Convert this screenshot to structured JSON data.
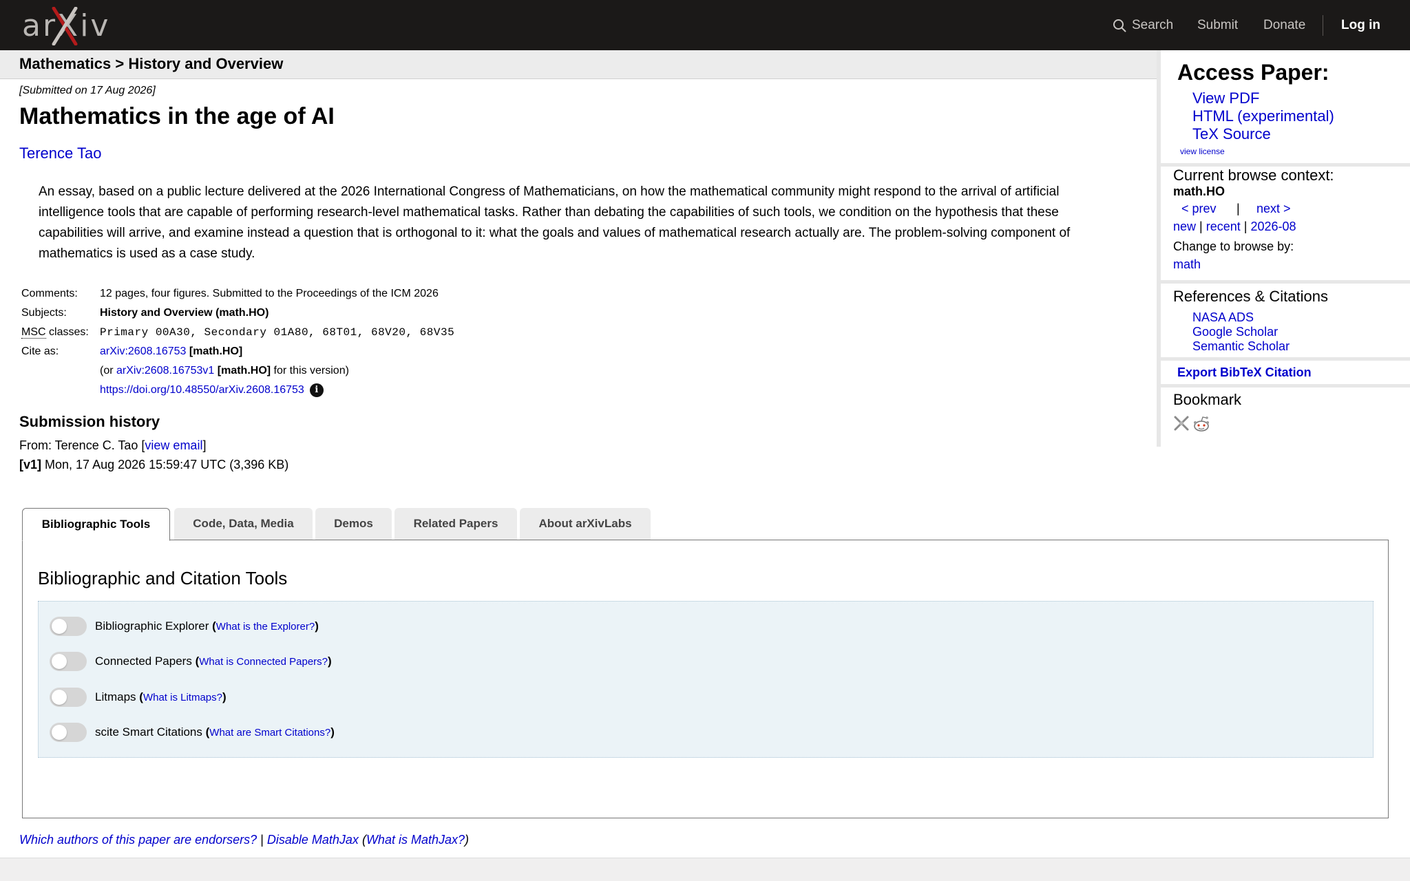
{
  "nav": {
    "logo_text": "arXiv",
    "search_label": "Search",
    "submit_label": "Submit",
    "donate_label": "Donate",
    "login_label": "Log in"
  },
  "breadcrumb": "Mathematics > History and Overview",
  "paper": {
    "submitted": "[Submitted on 17 Aug 2026]",
    "title": "Mathematics in the age of AI",
    "author": "Terence Tao",
    "abstract": "An essay, based on a public lecture delivered at the 2026 International Congress of Mathematicians, on how the mathematical community might respond to the arrival of artificial intelligence tools that are capable of performing research-level mathematical tasks. Rather than debating the capabilities of such tools, we condition on the hypothesis that these capabilities will arrive, and examine instead a question that is orthogonal to it: what the goals and values of mathematical research actually are. The problem-solving component of mathematics is used as a case study."
  },
  "meta": {
    "comments_label": "Comments:",
    "comments": "12 pages, four figures. Submitted to the Proceedings of the ICM 2026",
    "subjects_label": "Subjects:",
    "subjects": "History and Overview (math.HO)",
    "msc_abbr": "MSC",
    "msc_label_rest": " classes:",
    "msc": "Primary 00A30, Secondary 01A80, 68T01, 68V20, 68V35",
    "cite_label": "Cite as:",
    "cite_id": "arXiv:2608.16753",
    "cite_cat": " [math.HO]",
    "cite_or_prefix": "(or ",
    "cite_version": "arXiv:2608.16753v1",
    "cite_version_cat": " [math.HO]",
    "cite_version_suffix": " for this version)",
    "doi": "https://doi.org/10.48550/arXiv.2608.16753",
    "info_glyph": "i"
  },
  "submission_history": {
    "heading": "Submission history",
    "from_prefix": "From: Terence C. Tao [",
    "view_email": "view email",
    "from_suffix": "]",
    "v1_tag": "[v1]",
    "v1_text": " Mon, 17 Aug 2026 15:59:47 UTC (3,396 KB)"
  },
  "tabs": [
    {
      "label": "Bibliographic Tools",
      "active": true
    },
    {
      "label": "Code, Data, Media",
      "active": false
    },
    {
      "label": "Demos",
      "active": false
    },
    {
      "label": "Related Papers",
      "active": false
    },
    {
      "label": "About arXivLabs",
      "active": false
    }
  ],
  "panel": {
    "title": "Bibliographic and Citation Tools",
    "tools": [
      {
        "name": "Bibliographic Explorer",
        "help": "What is the Explorer?",
        "enabled": false
      },
      {
        "name": "Connected Papers",
        "help": "What is Connected Papers?",
        "enabled": false
      },
      {
        "name": "Litmaps",
        "help": "What is Litmaps?",
        "enabled": false
      },
      {
        "name": "scite Smart Citations",
        "help": "What are Smart Citations?",
        "enabled": false
      }
    ]
  },
  "footer": {
    "endorsers": "Which authors of this paper are endorsers?",
    "sep": " | ",
    "disable_mathjax": "Disable MathJax",
    "mathjax_open": " (",
    "what_mathjax": "What is MathJax?",
    "mathjax_close": ")"
  },
  "sidebar": {
    "access_heading": "Access Paper:",
    "access_links": [
      "View PDF",
      "HTML (experimental)",
      "TeX Source"
    ],
    "view_license": "view license",
    "browse_heading": "Current browse context:",
    "browse_context": "math.HO",
    "prev": "< prev",
    "pipe": "|",
    "next": "next >",
    "new": "new",
    "recent": "recent",
    "month": "2026-08",
    "change_label": "Change to browse by:",
    "change_link": "math",
    "refs_heading": "References & Citations",
    "refs": [
      "NASA ADS",
      "Google Scholar",
      "Semantic Scholar"
    ],
    "export_bibtex": "Export BibTeX Citation",
    "bookmark_heading": "Bookmark"
  },
  "colors": {
    "topbar": "#1b1918",
    "link": "#0000cc",
    "tool_box": "#ebf3f7"
  }
}
